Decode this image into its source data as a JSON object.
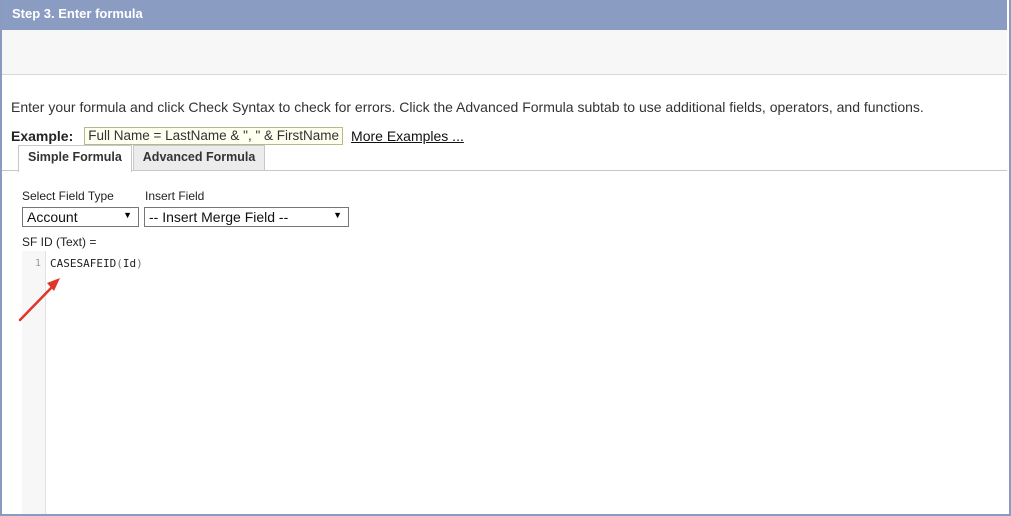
{
  "step": {
    "title": "Step 3. Enter formula"
  },
  "instructions": "Enter your formula and click Check Syntax to check for errors. Click the Advanced Formula subtab to use additional fields, operators, and functions.",
  "example": {
    "label": "Example:",
    "formula": "Full Name = LastName & \", \" & FirstName",
    "more_link": "More Examples ..."
  },
  "tabs": [
    {
      "label": "Simple Formula",
      "active": true
    },
    {
      "label": "Advanced Formula",
      "active": false
    }
  ],
  "field_type": {
    "label": "Select Field Type",
    "value": "Account"
  },
  "insert_field": {
    "label": "Insert Field",
    "value": "-- Insert Merge Field --"
  },
  "formula_target": "SF ID (Text) =",
  "editor": {
    "line_number": "1",
    "code_fn": "CASESAFEID",
    "code_open": "(",
    "code_arg": "Id",
    "code_close": ")"
  },
  "colors": {
    "header_bg": "#8b9cc2",
    "annotation_arrow": "#e0362a"
  }
}
